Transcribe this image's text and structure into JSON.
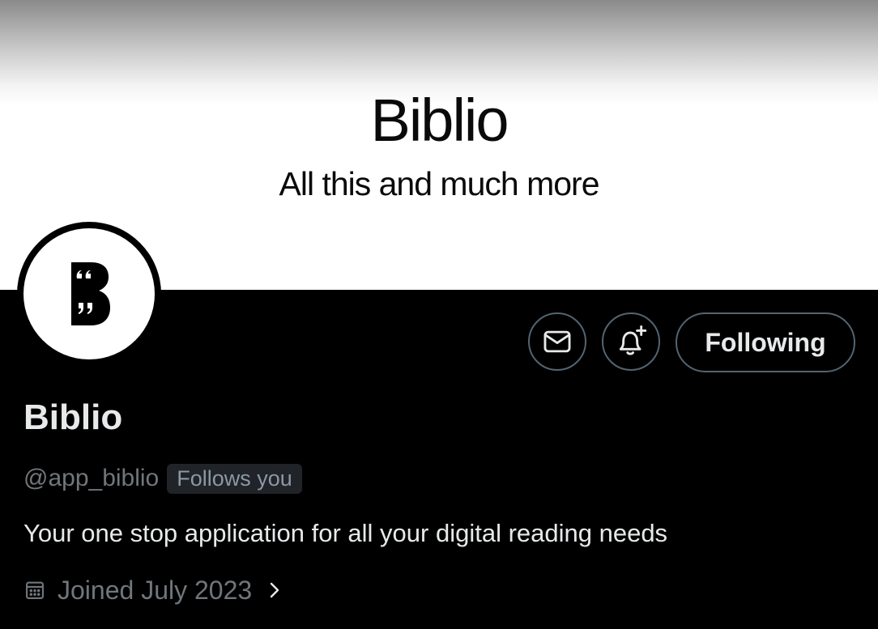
{
  "banner": {
    "title": "Biblio",
    "subtitle": "All this and much more"
  },
  "avatar": {
    "icon": "biblio-logo-b-quotes-icon"
  },
  "actions": {
    "message_icon": "mail-icon",
    "notify_icon": "bell-plus-icon",
    "follow_label": "Following"
  },
  "profile": {
    "display_name": "Biblio",
    "handle": "@app_biblio",
    "follows_badge": "Follows you",
    "bio": "Your one stop application for all your digital reading needs",
    "joined_icon": "calendar-icon",
    "joined": "Joined July 2023"
  },
  "colors": {
    "background": "#000000",
    "text_primary": "#e7e9ea",
    "text_secondary": "#71767b",
    "border": "#536471",
    "badge_bg": "#202327"
  }
}
